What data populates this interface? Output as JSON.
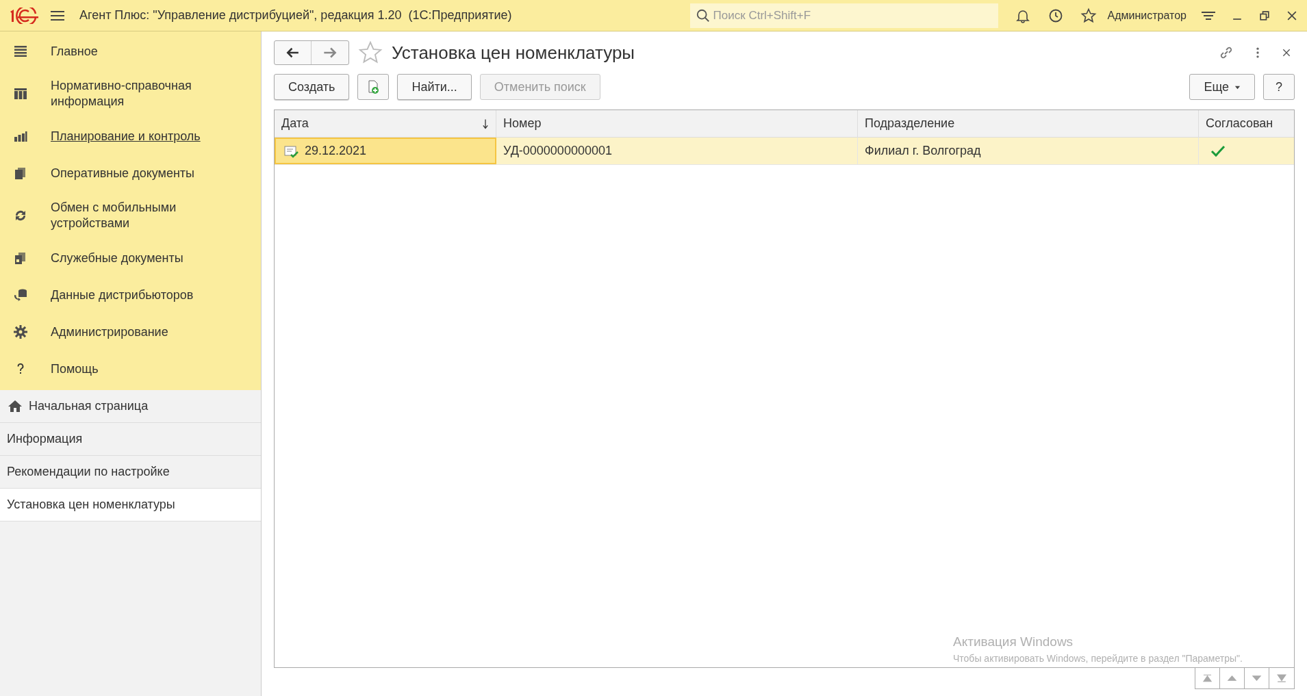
{
  "window": {
    "title": "Агент Плюс: \"Управление дистрибуцией\", редакция 1.20  (1С:Предприятие)"
  },
  "search": {
    "placeholder": "Поиск Ctrl+Shift+F"
  },
  "user": "Администратор",
  "sections": [
    {
      "kind": "list",
      "label": "Главное",
      "selected": false
    },
    {
      "kind": "grid",
      "label": "Нормативно-справочная информация",
      "selected": false
    },
    {
      "kind": "chart",
      "label": "Планирование и контроль",
      "selected": true
    },
    {
      "kind": "docs",
      "label": "Оперативные документы",
      "selected": false
    },
    {
      "kind": "sync",
      "label": "Обмен с мобильными устройствами",
      "selected": false
    },
    {
      "kind": "service",
      "label": "Служебные документы",
      "selected": false
    },
    {
      "kind": "data",
      "label": "Данные дистрибьюторов",
      "selected": false
    },
    {
      "kind": "gear",
      "label": "Администрирование",
      "selected": false
    },
    {
      "kind": "help",
      "label": "Помощь",
      "selected": false
    }
  ],
  "open_pages": [
    {
      "label": "Начальная страница",
      "home": true,
      "selected": false
    },
    {
      "label": "Информация",
      "home": false,
      "selected": false
    },
    {
      "label": "Рекомендации по настройке",
      "home": false,
      "selected": false
    },
    {
      "label": "Установка цен номенклатуры",
      "home": false,
      "selected": true
    }
  ],
  "form": {
    "title": "Установка цен номенклатуры",
    "buttons": [
      {
        "label": "Создать",
        "disabled": false
      },
      {
        "label": "Найти...",
        "disabled": false
      },
      {
        "label": "Отменить поиск",
        "disabled": true
      }
    ],
    "more": "Еще",
    "help": "?",
    "table": {
      "columns": [
        "Дата",
        "Номер",
        "Подразделение",
        "Согласован"
      ],
      "rows": [
        {
          "date": "29.12.2021",
          "number": "УД-0000000000001",
          "division": "Филиал г. Волгоград",
          "approved": true,
          "selected": true
        }
      ]
    }
  },
  "watermark": {
    "title": "Активация Windows",
    "text": "Чтобы активировать Windows, перейдите в раздел \"Параметры\"."
  }
}
